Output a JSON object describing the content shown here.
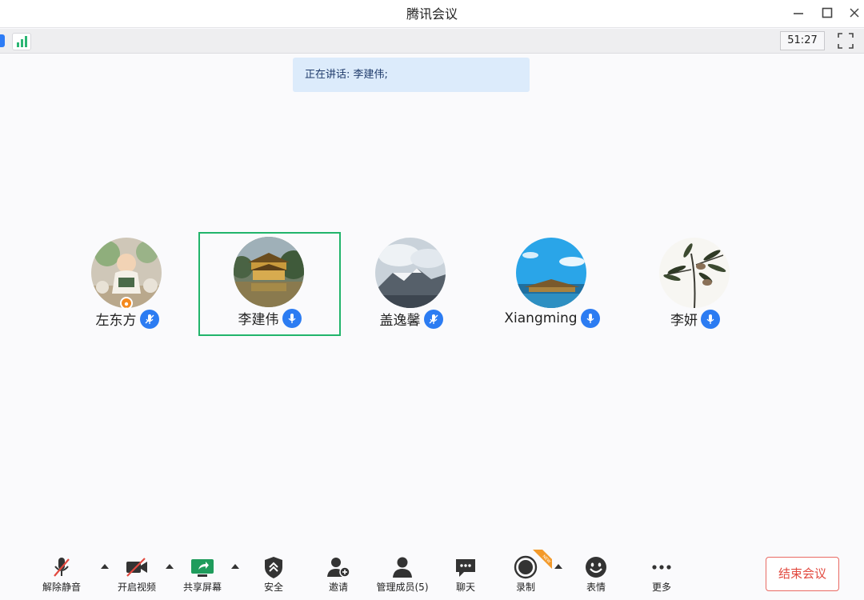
{
  "window": {
    "title": "腾讯会议"
  },
  "infobar": {
    "timer": "51:27"
  },
  "speaking_banner": "正在讲话: 李建伟;",
  "participants": [
    {
      "name": "左东方",
      "mic": "muted",
      "host": true,
      "active": false
    },
    {
      "name": "李建伟",
      "mic": "on",
      "host": false,
      "active": true
    },
    {
      "name": "盖逸馨",
      "mic": "muted",
      "host": false,
      "active": false
    },
    {
      "name": "Xiangming",
      "mic": "on",
      "host": false,
      "active": false
    },
    {
      "name": "李妍",
      "mic": "on",
      "host": false,
      "active": false
    }
  ],
  "toolbar": {
    "unmute": "解除静音",
    "start_video": "开启视频",
    "share_screen": "共享屏幕",
    "security": "安全",
    "invite": "邀请",
    "manage_members": "管理成员(5)",
    "chat": "聊天",
    "record": "录制",
    "record_badge": "NEW",
    "reactions": "表情",
    "more": "更多",
    "end_meeting": "结束会议"
  },
  "colors": {
    "accent_blue": "#2c7cf2",
    "active_border": "#21b46b",
    "end_red": "#e2493f",
    "banner_bg": "#dcebfb"
  }
}
